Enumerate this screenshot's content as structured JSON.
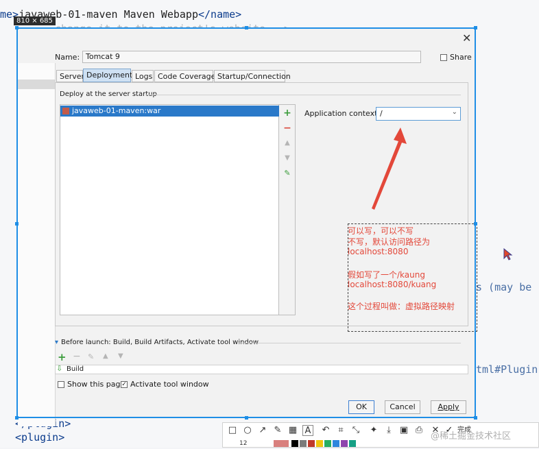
{
  "background_code": {
    "line1": "me>javaweb-01-maven Maven Webapp</name>",
    "line1_prefix": "me>",
    "line1_text": "javaweb-01-maven Maven Webapp",
    "line1_close": "</name>",
    "faint_line": "change it to the project's website -->",
    "right_text_1": "s (may be",
    "right_text_2": "tml#Plugin",
    "bottom_line_1": "</plugin>",
    "bottom_line_2": "<plugin>"
  },
  "dimension_badge": "810 × 685",
  "dialog": {
    "name_label": "Name:",
    "name_value": "Tomcat 9",
    "share_label": "Share",
    "tabs": [
      "Server",
      "Deployment",
      "Logs",
      "Code Coverage",
      "Startup/Connection"
    ],
    "active_tab": "Deployment",
    "deploy_section_label": "Deploy at the server startup",
    "deploy_items": [
      "javaweb-01-maven:war"
    ],
    "app_context_label": "Application context:",
    "app_context_value": "/",
    "before_launch_label": "Before launch: Build, Build Artifacts, Activate tool window",
    "build_item": "Build",
    "show_page_label": "Show this page",
    "activate_label": "Activate tool window",
    "ok_label": "OK",
    "cancel_label": "Cancel",
    "apply_label": "Apply"
  },
  "annotation": {
    "line1": "可以写，可以不写",
    "line2": "不写，默认访问路径为",
    "line3": "localhost:8080",
    "line4": "假如写了一个/kaung",
    "line5": "localhost:8080/kuang",
    "line6": "这个过程叫做：虚拟路径映射",
    "color": "#e3483a"
  },
  "snap_toolbar": {
    "finish_label": "完成",
    "font_size_value": "12"
  },
  "watermark": "@稀土掘金技术社区",
  "colors": {
    "selection": "#1e8ee6",
    "list_selected": "#2a79c9",
    "active_tab": "#cfe1f3"
  }
}
